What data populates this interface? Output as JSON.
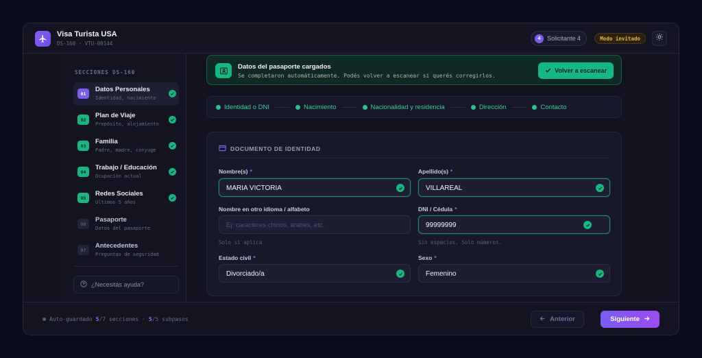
{
  "header": {
    "title": "Visa Turista USA",
    "subtitle": "DS-160 · VTU-00144",
    "applicant_label": "Solicitante 4",
    "applicant_number": "4",
    "guest_mode": "Modo invitado"
  },
  "sidebar": {
    "title": "SECCIONES DS-160",
    "items": [
      {
        "num": "01",
        "label": "Datos Personales",
        "sub": "Identidad, nacimiento",
        "state": "active"
      },
      {
        "num": "02",
        "label": "Plan de Viaje",
        "sub": "Propósito, alojamiento",
        "state": "done"
      },
      {
        "num": "03",
        "label": "Familia",
        "sub": "Padre, madre, cónyuge",
        "state": "done"
      },
      {
        "num": "04",
        "label": "Trabajo / Educación",
        "sub": "Ocupación actual",
        "state": "done"
      },
      {
        "num": "05",
        "label": "Redes Sociales",
        "sub": "Últimos 5 años",
        "state": "done"
      },
      {
        "num": "06",
        "label": "Pasaporte",
        "sub": "Datos del pasaporte",
        "state": "todo"
      },
      {
        "num": "07",
        "label": "Antecedentes",
        "sub": "Preguntas de seguridad",
        "state": "todo"
      }
    ],
    "help_label": "¿Necesitás ayuda?"
  },
  "banner": {
    "title": "Datos del pasaporte cargados",
    "description": "Se completaron automáticamente. Podés volver a escanear si querés corregirlos.",
    "rescan_label": "Volver a escanear"
  },
  "stepper": {
    "steps": [
      "Identidad o DNI",
      "Nacimiento",
      "Nacionalidad y residencia",
      "Dirección",
      "Contacto"
    ]
  },
  "form": {
    "section_title": "DOCUMENTO DE IDENTIDAD",
    "nombres_label": "Nombre(s)",
    "nombres_value": "MARIA VICTORIA",
    "apellidos_label": "Apellido(s)",
    "apellidos_value": "VILLAREAL",
    "otro_idioma_label": "Nombre en otro idioma / alfabeto",
    "otro_idioma_placeholder": "Ej: caracteres chinos, árabes, etc.",
    "otro_idioma_hint": "Solo si aplica",
    "dni_label": "DNI / Cédula",
    "dni_value": "99999999",
    "dni_hint": "Sin espacios. Solo números.",
    "estado_civil_label": "Estado civil",
    "estado_civil_value": "Divorciado/a",
    "sexo_label": "Sexo",
    "sexo_value": "Femenino",
    "required_mark": "*"
  },
  "footer": {
    "autosave_prefix": "Auto-guardado",
    "sections_done": "5",
    "sections_total": "/7 secciones ·",
    "substeps_done": "5",
    "substeps_total": "/5 subpasos",
    "prev_label": "Anterior",
    "next_label": "Siguiente"
  },
  "colors": {
    "accent": "#7c5cf0",
    "success": "#10b981",
    "warning": "#f0b43c",
    "background": "#0c0d1a"
  }
}
